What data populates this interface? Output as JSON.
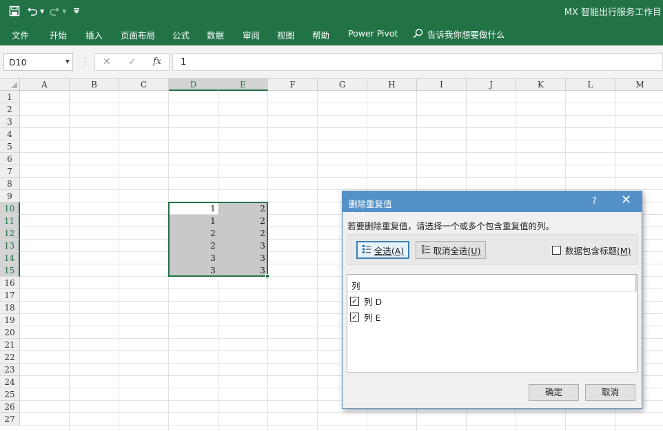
{
  "window": {
    "title": "MX 智能出行服务工作目"
  },
  "ribbon": {
    "tabs": [
      "文件",
      "开始",
      "插入",
      "页面布局",
      "公式",
      "数据",
      "审阅",
      "视图",
      "帮助",
      "Power Pivot"
    ],
    "tell_me": "告诉我你想要做什么"
  },
  "formula_bar": {
    "name_box": "D10",
    "formula": "1",
    "fx": "fx"
  },
  "sheet": {
    "columns": [
      "A",
      "B",
      "C",
      "D",
      "E",
      "F",
      "G",
      "H",
      "I",
      "J",
      "K",
      "L",
      "M"
    ],
    "rows": [
      "1",
      "2",
      "3",
      "4",
      "5",
      "6",
      "7",
      "8",
      "9",
      "10",
      "11",
      "12",
      "13",
      "14",
      "15",
      "16",
      "17",
      "18",
      "19",
      "20",
      "21",
      "22",
      "23",
      "24",
      "25",
      "26",
      "27"
    ],
    "selected_columns": [
      "D",
      "E"
    ],
    "selected_rows": [
      "10",
      "11",
      "12",
      "13",
      "14",
      "15"
    ],
    "data_rows": [
      {
        "row": "10",
        "d": "1",
        "e": "2"
      },
      {
        "row": "11",
        "d": "1",
        "e": "2"
      },
      {
        "row": "12",
        "d": "2",
        "e": "2"
      },
      {
        "row": "13",
        "d": "2",
        "e": "3"
      },
      {
        "row": "14",
        "d": "3",
        "e": "3"
      },
      {
        "row": "15",
        "d": "3",
        "e": "3"
      }
    ]
  },
  "dialog": {
    "title": "删除重复值",
    "help": "?",
    "message": "若要删除重复值，请选择一个或多个包含重复值的列。",
    "select_all": {
      "label": "全选",
      "key": "(A)"
    },
    "unselect_all": {
      "label": "取消全选",
      "key": "(U)"
    },
    "header_checkbox": {
      "label": "数据包含标题",
      "key": "(M)",
      "checked": false
    },
    "list_header": "列",
    "columns": [
      {
        "label": "列 D",
        "checked": true
      },
      {
        "label": "列 E",
        "checked": true
      }
    ],
    "ok": "确定",
    "cancel": "取消"
  },
  "colors": {
    "excel_green": "#217346",
    "dialog_title": "#5591c9",
    "selection_shade": "#c9c9c9"
  }
}
